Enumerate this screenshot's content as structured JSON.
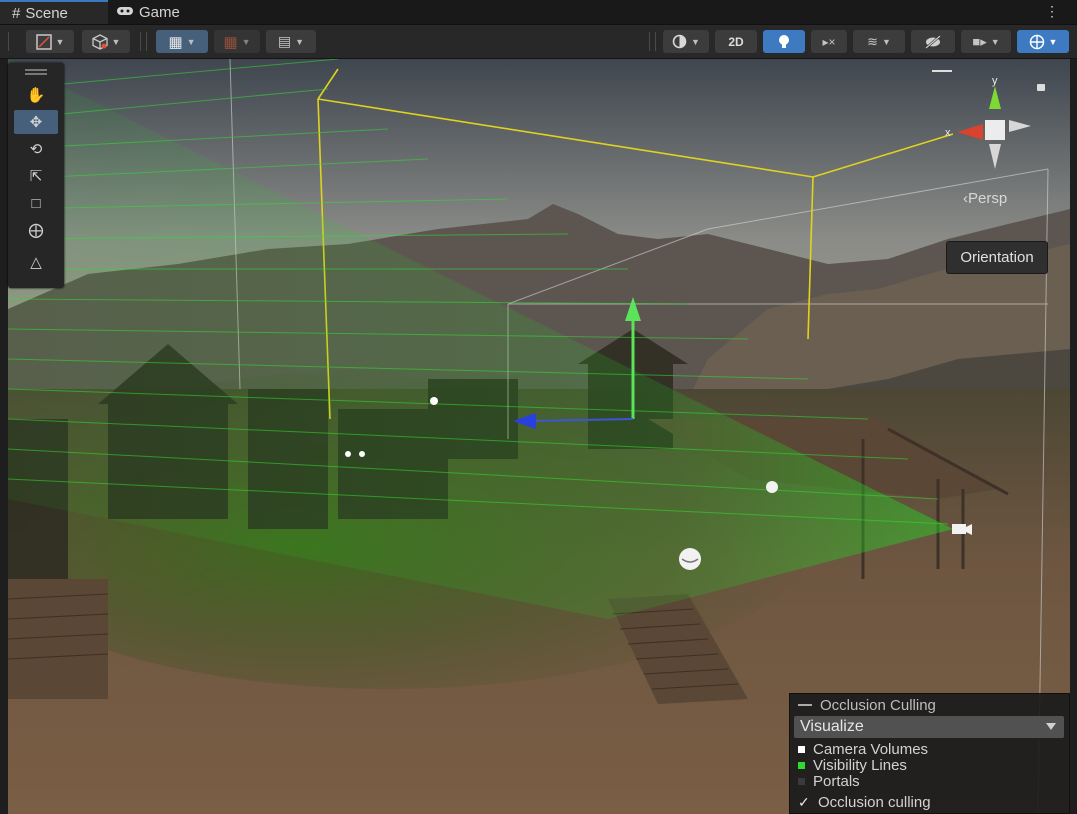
{
  "tabs": [
    {
      "label": "Scene",
      "icon": "scene-grid-icon"
    },
    {
      "label": "Game",
      "icon": "gamepad-icon"
    }
  ],
  "toolbar": {
    "mode_2d_label": "2D"
  },
  "tools_palette": {
    "items": [
      "hand-tool-icon",
      "move-tool-icon",
      "rotate-tool-icon",
      "scale-tool-icon",
      "rect-tool-icon",
      "transform-tool-icon",
      "custom-tool-icon"
    ],
    "active": "move-tool-icon"
  },
  "gizmo": {
    "axis_x": "x",
    "axis_y": "y",
    "projection_label": "‹Persp",
    "tooltip": "Orientation"
  },
  "occlusion_culling": {
    "title": "Occlusion Culling",
    "mode_select": "Visualize",
    "legend": [
      {
        "label": "Camera Volumes",
        "color": "#ffffff"
      },
      {
        "label": "Visibility Lines",
        "color": "#2fd92f"
      },
      {
        "label": "Portals",
        "color": "#3a3a3a"
      }
    ],
    "toggle_label": "Occlusion culling",
    "toggle_checked": true
  },
  "colors": {
    "accent_blue": "#3d7ac2",
    "visibility_green": "#33dd33",
    "volume_yellow": "#e0d21e"
  }
}
